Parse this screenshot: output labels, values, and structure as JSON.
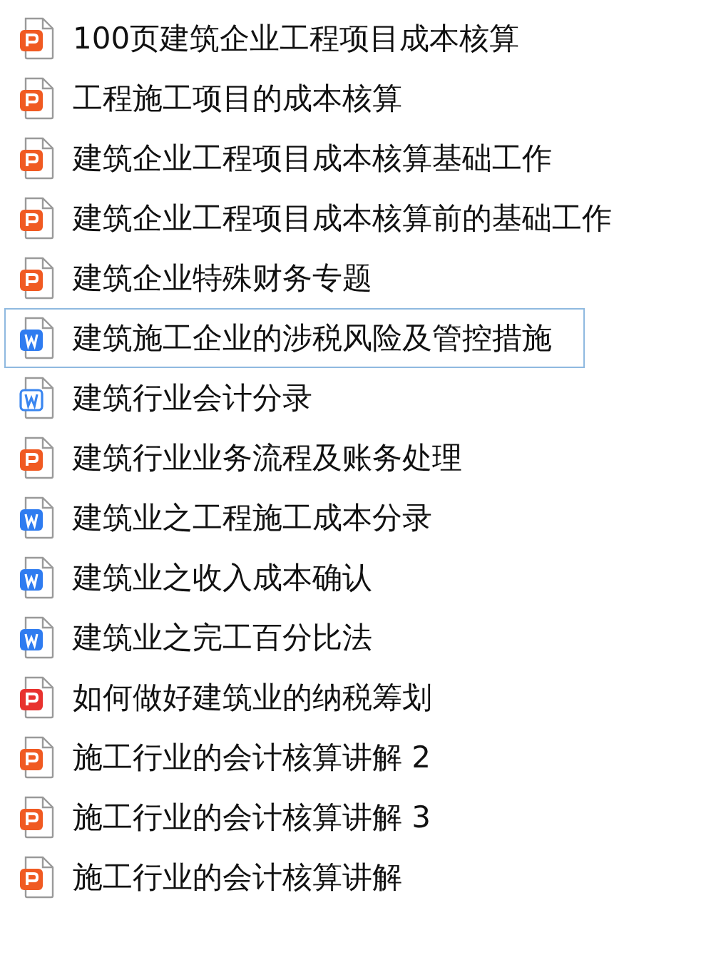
{
  "files": [
    {
      "name": "100页建筑企业工程项目成本核算",
      "kind": "ppt",
      "selected": false
    },
    {
      "name": "工程施工项目的成本核算",
      "kind": "ppt",
      "selected": false
    },
    {
      "name": "建筑企业工程项目成本核算基础工作",
      "kind": "ppt",
      "selected": false
    },
    {
      "name": "建筑企业工程项目成本核算前的基础工作",
      "kind": "ppt",
      "selected": false
    },
    {
      "name": "建筑企业特殊财务专题",
      "kind": "ppt",
      "selected": false
    },
    {
      "name": "建筑施工企业的涉税风险及管控措施",
      "kind": "doc",
      "selected": true
    },
    {
      "name": "建筑行业会计分录",
      "kind": "doclight",
      "selected": false
    },
    {
      "name": "建筑行业业务流程及账务处理",
      "kind": "ppt",
      "selected": false
    },
    {
      "name": "建筑业之工程施工成本分录",
      "kind": "doc",
      "selected": false
    },
    {
      "name": "建筑业之收入成本确认",
      "kind": "doc",
      "selected": false
    },
    {
      "name": "建筑业之完工百分比法",
      "kind": "doc",
      "selected": false
    },
    {
      "name": "如何做好建筑业的纳税筹划",
      "kind": "pdf",
      "selected": false
    },
    {
      "name": "施工行业的会计核算讲解 2",
      "kind": "ppt",
      "selected": false
    },
    {
      "name": "施工行业的会计核算讲解 3",
      "kind": "ppt",
      "selected": false
    },
    {
      "name": "施工行业的会计核算讲解",
      "kind": "ppt",
      "selected": false
    }
  ]
}
